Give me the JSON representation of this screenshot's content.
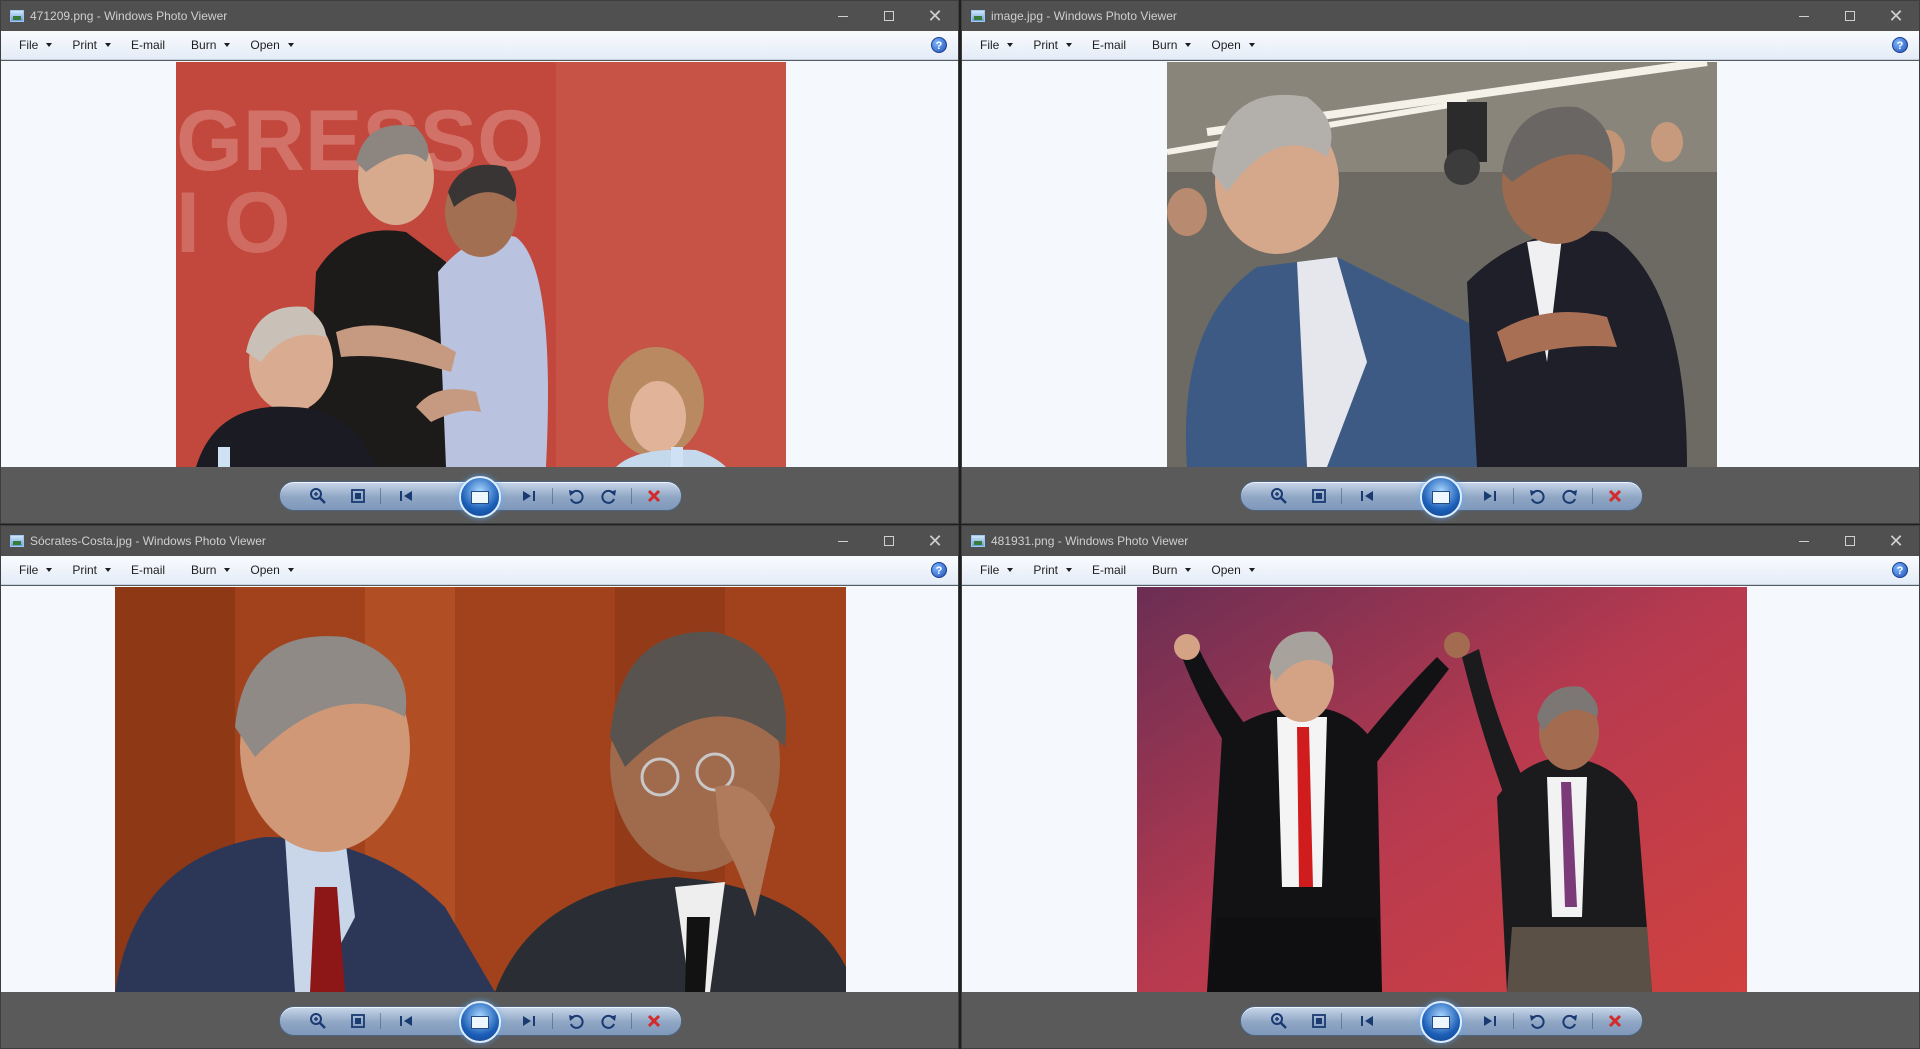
{
  "windows": [
    {
      "title": "471209.png - Windows Photo Viewer",
      "photo_desc_icon": "photo-congress-embrace",
      "photo_bg": "#c2473d",
      "photo_text": "GRESSO"
    },
    {
      "title": "image.jpg - Windows Photo Viewer",
      "photo_desc_icon": "photo-crowd-embrace",
      "photo_bg": "#6d6a63"
    },
    {
      "title": "Sócrates-Costa.jpg - Windows Photo Viewer",
      "photo_desc_icon": "photo-two-men-talking",
      "photo_bg": "#a2421d"
    },
    {
      "title": "481931.png - Windows Photo Viewer",
      "photo_desc_icon": "photo-raised-arms",
      "photo_bg": "#a8323f"
    }
  ],
  "menu": {
    "file": "File",
    "print": "Print",
    "email": "E-mail",
    "burn": "Burn",
    "open": "Open",
    "help": "?"
  },
  "toolbar_icons": [
    "zoom-icon",
    "actual-size-icon",
    "previous-icon",
    "slideshow-icon",
    "next-icon",
    "rotate-left-icon",
    "rotate-right-icon",
    "delete-icon"
  ],
  "colors": {
    "titlebar": "#505050",
    "menubar": "#e4ecf7",
    "viewer_bg": "#f5f8fc",
    "toolbar_bg": "#5a5a5a",
    "accent": "#1c5fb8",
    "delete": "#d42a2a"
  }
}
